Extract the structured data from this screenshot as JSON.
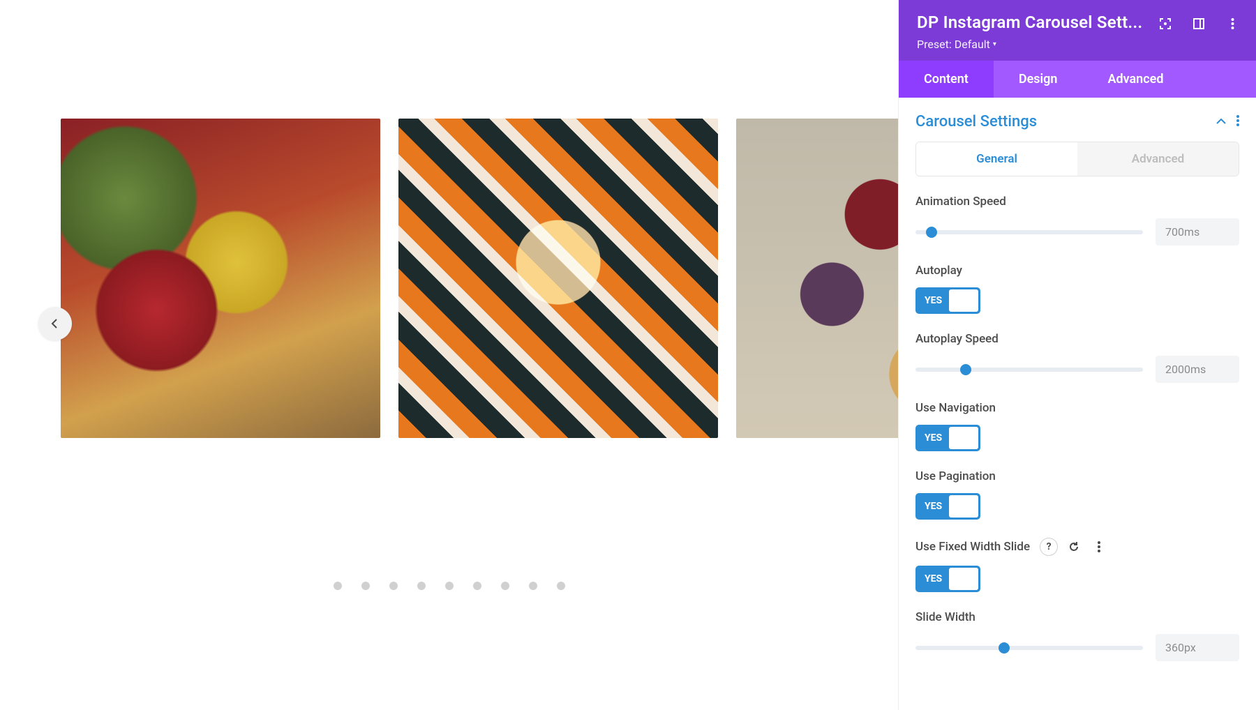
{
  "panel": {
    "title": "DP Instagram Carousel Sett...",
    "preset_label": "Preset:",
    "preset_value": "Default"
  },
  "tabs": {
    "content": "Content",
    "design": "Design",
    "advanced": "Advanced"
  },
  "section": {
    "title": "Carousel Settings",
    "subtabs": {
      "general": "General",
      "advanced": "Advanced"
    }
  },
  "settings": {
    "animation_speed": {
      "label": "Animation Speed",
      "value": "700ms",
      "thumb_pct": 7
    },
    "autoplay": {
      "label": "Autoplay",
      "value_label": "YES"
    },
    "autoplay_speed": {
      "label": "Autoplay Speed",
      "value": "2000ms",
      "thumb_pct": 22
    },
    "use_navigation": {
      "label": "Use Navigation",
      "value_label": "YES"
    },
    "use_pagination": {
      "label": "Use Pagination",
      "value_label": "YES"
    },
    "use_fixed_width": {
      "label": "Use Fixed Width Slide",
      "value_label": "YES"
    },
    "slide_width": {
      "label": "Slide Width",
      "value": "360px",
      "thumb_pct": 39
    }
  },
  "carousel": {
    "dot_count": 9
  }
}
